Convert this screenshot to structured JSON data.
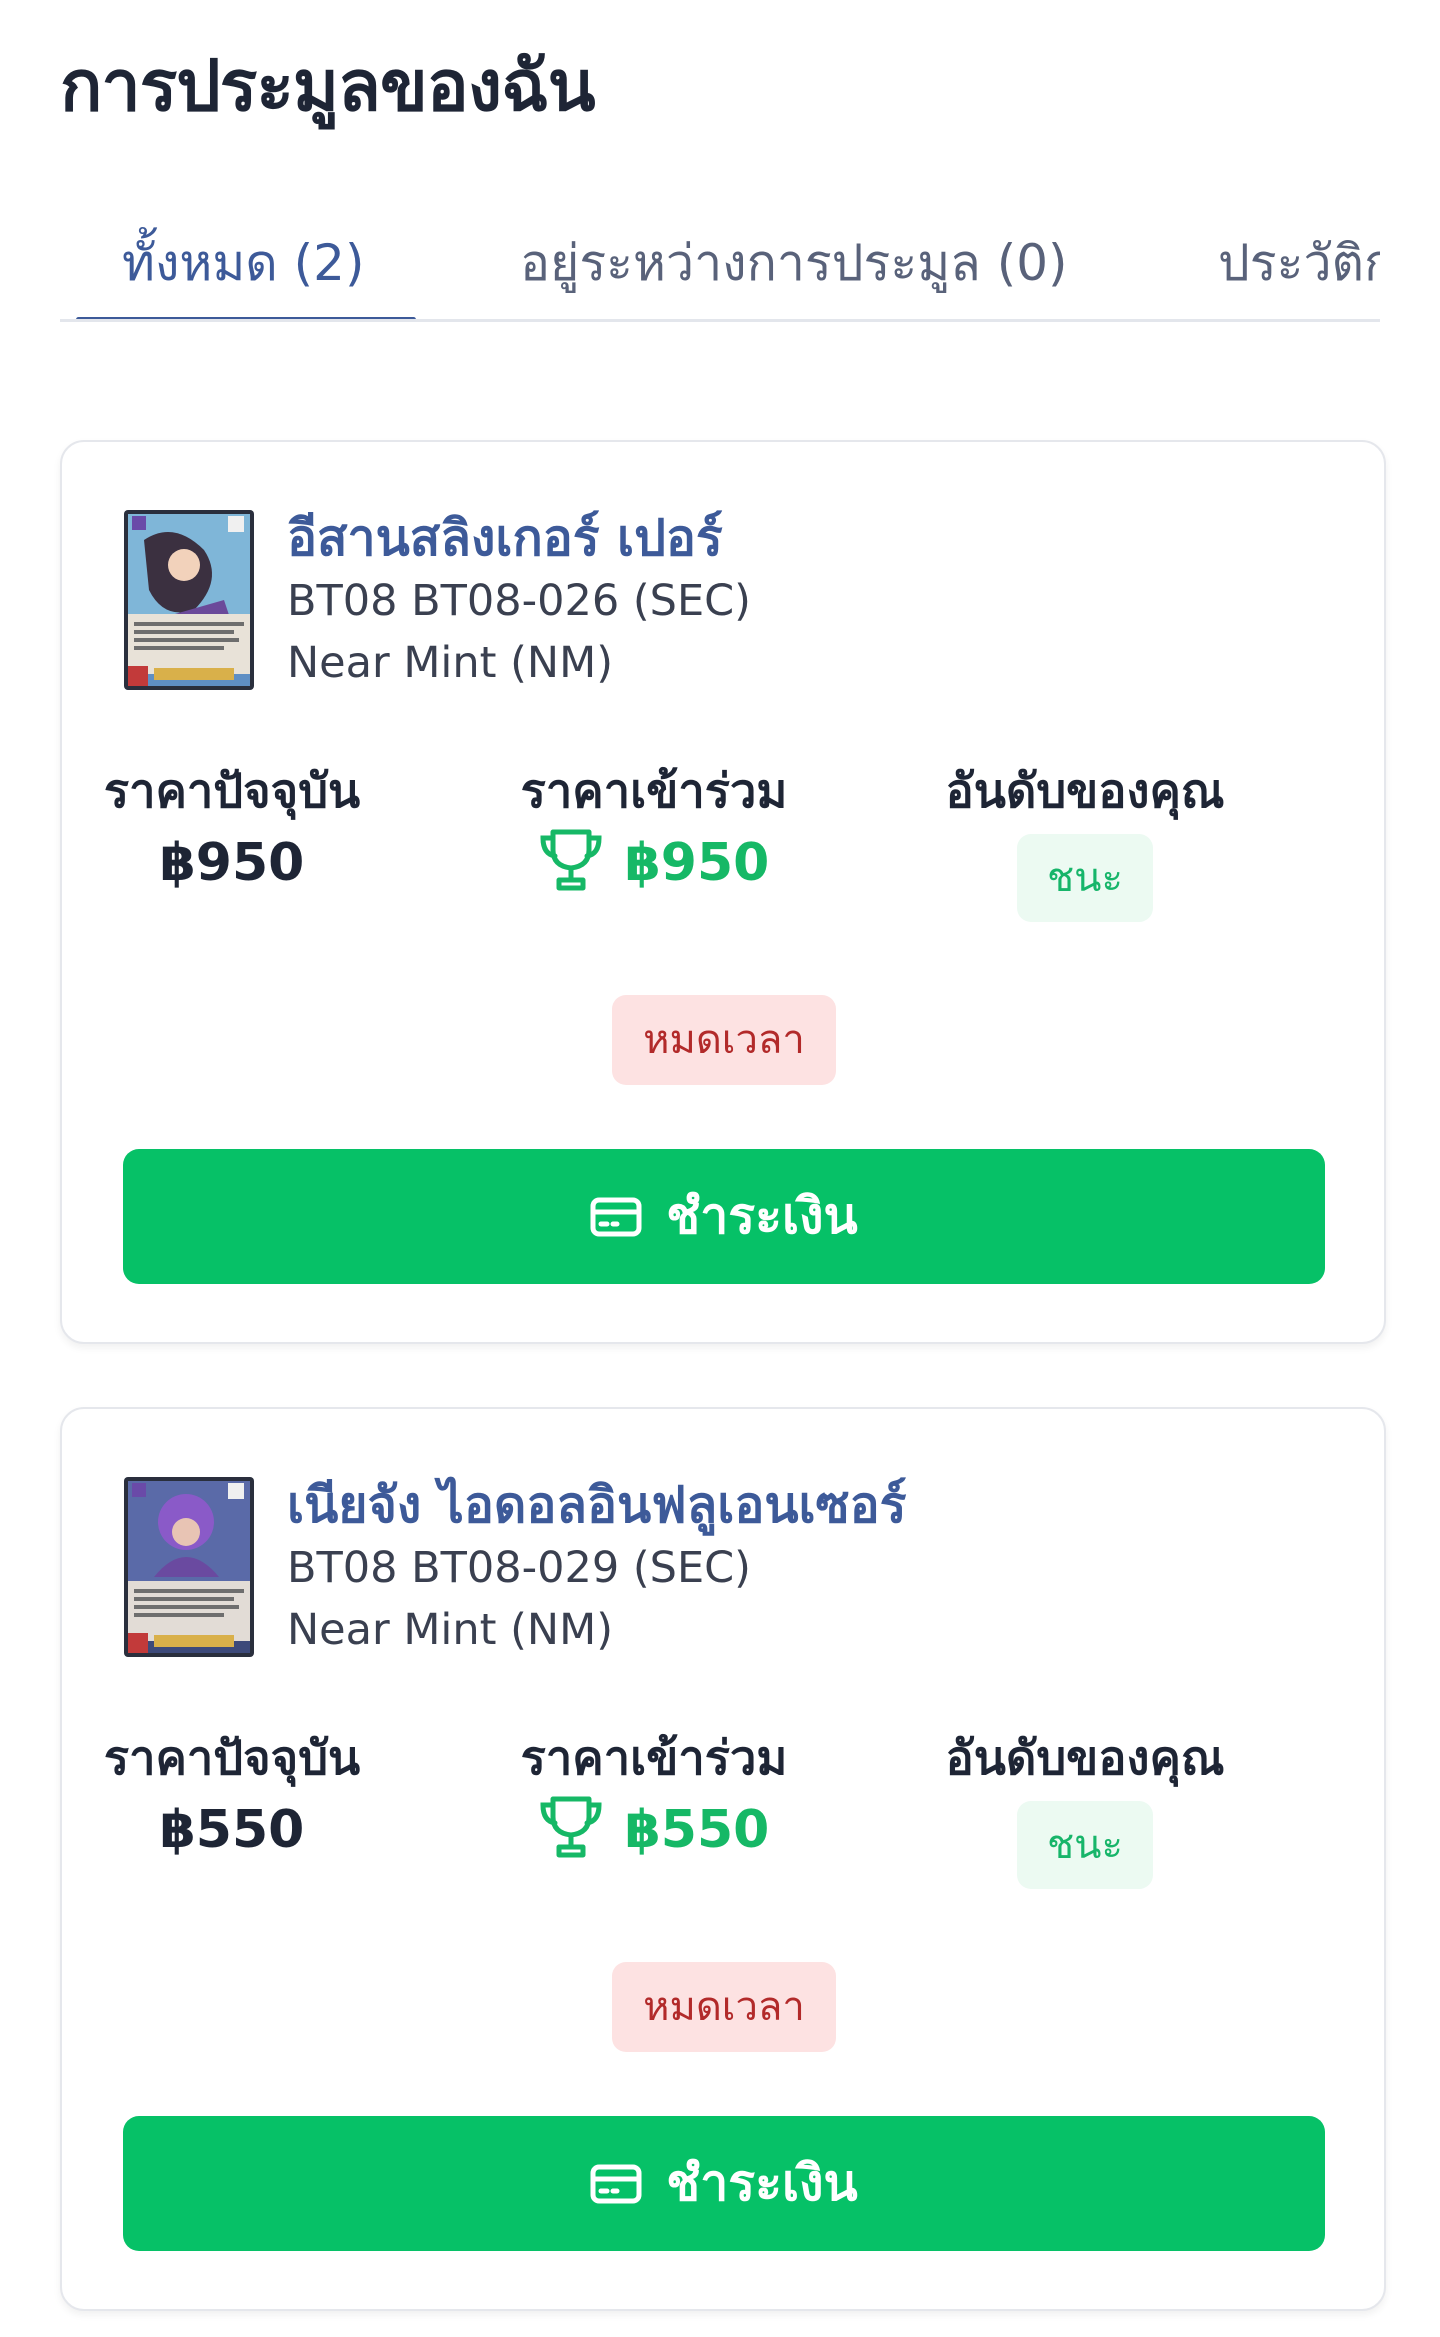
{
  "page": {
    "title": "การประมูลของฉัน"
  },
  "tabs": [
    {
      "label": "ทั้งหมด (2)",
      "active": true
    },
    {
      "label": "อยู่ระหว่างการประมูล (0)",
      "active": false
    },
    {
      "label": "ประวัติก",
      "active": false
    }
  ],
  "labels": {
    "current_price": "ราคาปัจจุบัน",
    "bid_price": "ราคาเข้าร่วม",
    "your_rank": "อันดับของคุณ",
    "pay_button": "ชำระเงิน"
  },
  "auctions": [
    {
      "name": "อีสานสลิงเกอร์ เปอร์",
      "code": "BT08 BT08-026 (SEC)",
      "condition": "Near Mint (NM)",
      "current_price": "฿950",
      "bid_price": "฿950",
      "rank_status": "ชนะ",
      "time_status": "หมดเวลา"
    },
    {
      "name": "เนียจัง ไอดอลอินฟลูเอนเซอร์",
      "code": "BT08 BT08-029 (SEC)",
      "condition": "Near Mint (NM)",
      "current_price": "฿550",
      "bid_price": "฿550",
      "rank_status": "ชนะ",
      "time_status": "หมดเวลา"
    }
  ],
  "colors": {
    "accent": "#3d5a99",
    "success": "#06c167",
    "win_badge_bg": "#ecfaf2",
    "expired_bg": "#fde2e2",
    "expired_text": "#b22a2a"
  },
  "icons": {
    "trophy": "trophy-icon",
    "payment": "credit-card-icon",
    "card_image": "trading-card-thumbnail"
  }
}
